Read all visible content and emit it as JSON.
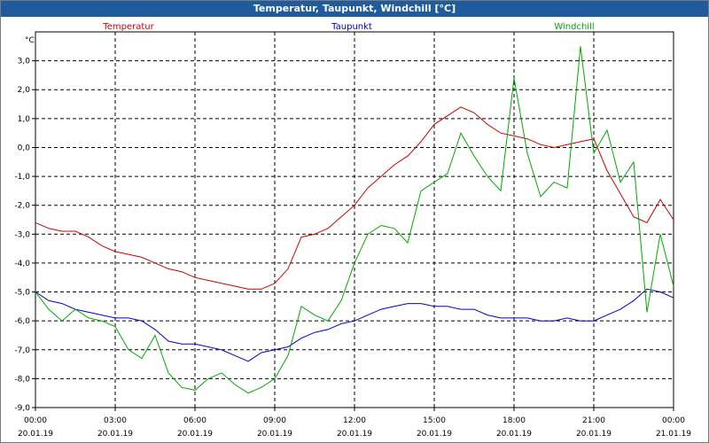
{
  "window": {
    "title": "Temperatur, Taupunkt, Windchill [°C]"
  },
  "chart_data": {
    "type": "line",
    "title": "Temperatur, Taupunkt, Windchill [°C]",
    "ylabel": "°C",
    "ylim": [
      -9.0,
      4.0
    ],
    "y_ticks": [
      "3,0",
      "2,0",
      "1,0",
      "0,0",
      "-1,0",
      "-2,0",
      "-3,0",
      "-4,0",
      "-5,0",
      "-6,0",
      "-7,0",
      "-8,0",
      "-9,0"
    ],
    "x_ticks": [
      {
        "time": "00:00",
        "date": "20.01.19"
      },
      {
        "time": "03:00",
        "date": "20.01.19"
      },
      {
        "time": "06:00",
        "date": "20.01.19"
      },
      {
        "time": "09:00",
        "date": "20.01.19"
      },
      {
        "time": "12:00",
        "date": "20.01.19"
      },
      {
        "time": "15:00",
        "date": "20.01.19"
      },
      {
        "time": "18:00",
        "date": "20.01.19"
      },
      {
        "time": "21:00",
        "date": "20.01.19"
      },
      {
        "time": "00:00",
        "date": "21.01.19"
      }
    ],
    "grid": true,
    "legend_position": "top",
    "x_hours": [
      0,
      0.5,
      1,
      1.5,
      2,
      2.5,
      3,
      3.5,
      4,
      4.5,
      5,
      5.5,
      6,
      6.5,
      7,
      7.5,
      8,
      8.5,
      9,
      9.5,
      10,
      10.5,
      11,
      11.5,
      12,
      12.5,
      13,
      13.5,
      14,
      14.5,
      15,
      15.5,
      16,
      16.5,
      17,
      17.5,
      18,
      18.5,
      19,
      19.5,
      20,
      20.5,
      21,
      21.5,
      22,
      22.5,
      23,
      23.5,
      24
    ],
    "series": [
      {
        "name": "Temperatur",
        "color": "#cc0000",
        "values": [
          -2.6,
          -2.8,
          -2.9,
          -2.9,
          -3.1,
          -3.4,
          -3.6,
          -3.7,
          -3.8,
          -4.0,
          -4.2,
          -4.3,
          -4.5,
          -4.6,
          -4.7,
          -4.8,
          -4.9,
          -4.9,
          -4.7,
          -4.2,
          -3.1,
          -3.0,
          -2.8,
          -2.4,
          -2.0,
          -1.4,
          -1.0,
          -0.6,
          -0.3,
          0.2,
          0.8,
          1.1,
          1.4,
          1.2,
          0.8,
          0.5,
          0.4,
          0.3,
          0.1,
          0.0,
          0.1,
          0.2,
          0.3,
          -0.8,
          -1.6,
          -2.4,
          -2.6,
          -1.8,
          -2.5
        ]
      },
      {
        "name": "Taupunkt",
        "color": "#0000cc",
        "values": [
          -5.0,
          -5.3,
          -5.4,
          -5.6,
          -5.7,
          -5.8,
          -5.9,
          -5.9,
          -6.0,
          -6.3,
          -6.7,
          -6.8,
          -6.8,
          -6.9,
          -7.0,
          -7.2,
          -7.4,
          -7.1,
          -7.0,
          -6.9,
          -6.6,
          -6.4,
          -6.3,
          -6.1,
          -6.0,
          -5.8,
          -5.6,
          -5.5,
          -5.4,
          -5.4,
          -5.5,
          -5.5,
          -5.6,
          -5.6,
          -5.8,
          -5.9,
          -5.9,
          -5.9,
          -6.0,
          -6.0,
          -5.9,
          -6.0,
          -6.0,
          -5.8,
          -5.6,
          -5.3,
          -4.9,
          -5.0,
          -5.2
        ]
      },
      {
        "name": "Windchill",
        "color": "#00aa00",
        "values": [
          -5.0,
          -5.6,
          -6.0,
          -5.6,
          -5.9,
          -6.0,
          -6.2,
          -7.0,
          -7.3,
          -6.5,
          -7.8,
          -8.3,
          -8.4,
          -8.0,
          -7.8,
          -8.2,
          -8.5,
          -8.3,
          -8.0,
          -7.2,
          -5.5,
          -5.8,
          -6.0,
          -5.3,
          -4.0,
          -3.0,
          -2.7,
          -2.8,
          -3.3,
          -1.5,
          -1.2,
          -0.9,
          0.5,
          -0.3,
          -1.0,
          -1.5,
          2.4,
          -0.2,
          -1.7,
          -1.2,
          -1.4,
          3.5,
          -0.2,
          0.6,
          -1.2,
          -0.5,
          -5.7,
          -3.0,
          -4.8
        ]
      }
    ]
  }
}
